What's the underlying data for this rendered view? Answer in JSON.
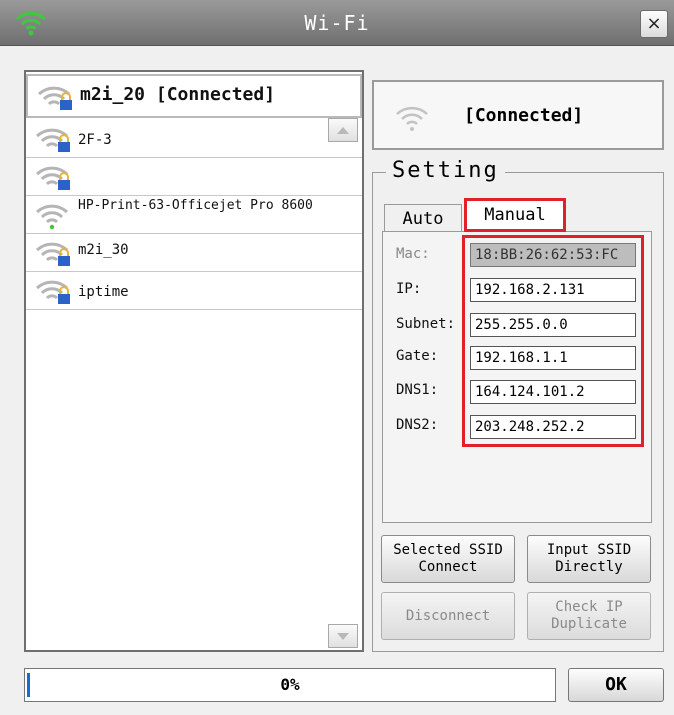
{
  "window": {
    "title": "Wi-Fi",
    "close_glyph": "×"
  },
  "networks": [
    {
      "ssid": "m2i_20 [Connected]",
      "icon": "wifi-lock-icon",
      "connected": true
    },
    {
      "ssid": "2F-3",
      "icon": "wifi-lock-icon"
    },
    {
      "ssid": "",
      "icon": "wifi-lock-icon"
    },
    {
      "ssid": "HP-Print-63-Officejet Pro 8600",
      "icon": "wifi-icon"
    },
    {
      "ssid": "m2i_30",
      "icon": "wifi-lock-icon"
    },
    {
      "ssid": "iptime",
      "icon": "wifi-lock-icon"
    }
  ],
  "status": {
    "text": "[Connected]",
    "icon": "wifi-icon"
  },
  "setting": {
    "legend": "Setting",
    "tabs": {
      "auto": "Auto",
      "manual": "Manual",
      "active": "manual"
    },
    "fields": {
      "mac": {
        "label": "Mac:",
        "value": "18:BB:26:62:53:FC",
        "disabled": true
      },
      "ip": {
        "label": "IP:",
        "value": "192.168.2.131"
      },
      "subnet": {
        "label": "Subnet:",
        "value": "255.255.0.0"
      },
      "gate": {
        "label": "Gate:",
        "value": "192.168.1.1"
      },
      "dns1": {
        "label": "DNS1:",
        "value": "164.124.101.2"
      },
      "dns2": {
        "label": "DNS2:",
        "value": "203.248.252.2"
      }
    }
  },
  "buttons": {
    "selected_ssid_connect": "Selected SSID\nConnect",
    "input_ssid_directly": "Input SSID\nDirectly",
    "disconnect": "Disconnect",
    "check_ip_duplicate": "Check IP\nDuplicate",
    "ok": "OK"
  },
  "progress": {
    "text": "0%",
    "value": 0
  },
  "colors": {
    "highlight_red": "#e0202a",
    "wifi_green": "#3ec83e",
    "lock_blue": "#2a62c9"
  }
}
